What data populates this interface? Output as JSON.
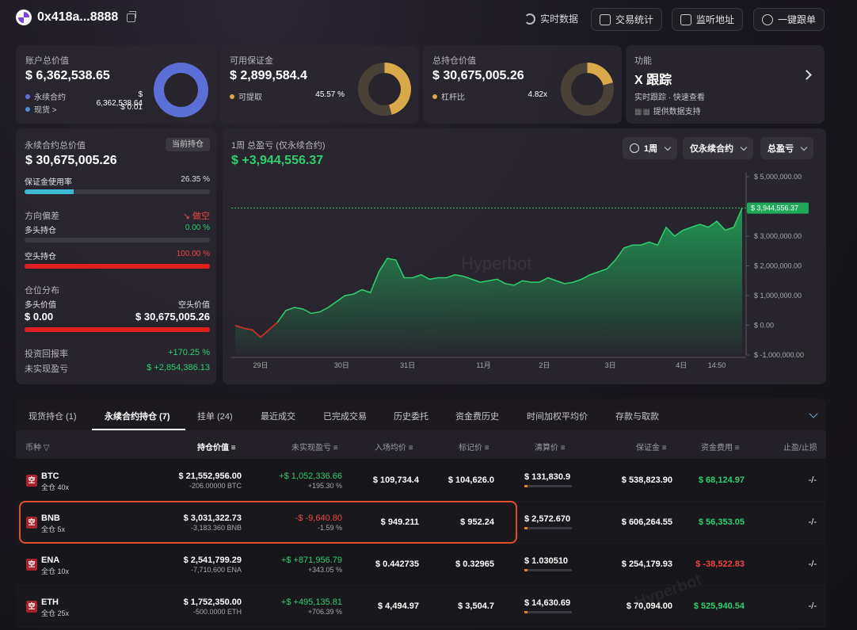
{
  "header": {
    "address": "0x418a...8888",
    "live_label": "实时数据",
    "stats_label": "交易统计",
    "monitor_label": "监听地址",
    "copy_label": "一键跟单"
  },
  "account": {
    "title": "账户总价值",
    "value": "$ 6,362,538.65",
    "perp_label": "永续合约",
    "perp_value": "$ 6,362,538.64",
    "spot_label": "现货 >",
    "spot_value": "$ 0.01",
    "perp_color": "#5b6fd6",
    "spot_color": "#4a8fd8",
    "perp_share": 0.99
  },
  "margin": {
    "title": "可用保证金",
    "value": "$ 2,899,584.4",
    "withdraw_label": "可提取",
    "withdraw_pct": "45.57 %",
    "color": "#d9a949",
    "share": 0.4557
  },
  "holdings": {
    "title": "总持仓价值",
    "value": "$ 30,675,005.26",
    "lev_label": "杠杆比",
    "lev_value": "4.82x",
    "color": "#d9a949",
    "share": 0.21
  },
  "feature": {
    "title": "功能",
    "name": "X 跟踪",
    "desc": "实时跟踪 · 快速查看",
    "support": "提供数据支持"
  },
  "perp_panel": {
    "title": "永续合约总价值",
    "badge": "当前持仓",
    "value": "$ 30,675,005.26",
    "margin_usage_label": "保证金使用率",
    "margin_usage_value": "26.35 %",
    "margin_usage": 0.2635,
    "bias_label": "方向偏差",
    "bias_value": "做空",
    "long_label": "多头持仓",
    "long_pct": "0.00 %",
    "long_share": 0,
    "short_label": "空头持仓",
    "short_pct": "100.00 %",
    "short_share": 1,
    "dist_label": "仓位分布",
    "long_value_label": "多头价值",
    "short_value_label": "空头价值",
    "long_value": "$ 0.00",
    "short_value": "$ 30,675,005.26",
    "roi_label": "投资回报率",
    "roi_value": "+170.25 %",
    "upnl_label": "未实现盈亏",
    "upnl_value": "$ +2,854,386.13"
  },
  "pnl_chart": {
    "title": "1周 总盈亏 (仅永续合约)",
    "value": "$ +3,944,556.37",
    "period": "1周",
    "filter": "仅永续合约",
    "metric": "总盈亏",
    "watermark": "Hyperbot",
    "current_tag": "$ 3,944,556.37"
  },
  "chart_data": {
    "type": "area",
    "title": "1周 总盈亏 (仅永续合约)",
    "x_ticks": [
      "29日",
      "30日",
      "31日",
      "11月",
      "2日",
      "3日",
      "4日",
      "14:50"
    ],
    "y_ticks": [
      "$ 5,000,000.00",
      "$ 4,000,000.00",
      "$ 3,000,000.00",
      "$ 2,000,000.00",
      "$ 1,000,000.00",
      "$ 0.00",
      "$ -1,000,000.00"
    ],
    "ylim": [
      -1000000,
      5000000
    ],
    "values": [
      0,
      -100000,
      -150000,
      -400000,
      -150000,
      100000,
      500000,
      600000,
      550000,
      400000,
      450000,
      600000,
      800000,
      1000000,
      1050000,
      1200000,
      1100000,
      1800000,
      2250000,
      2200000,
      1600000,
      1600000,
      1700000,
      1550000,
      1600000,
      1600000,
      1700000,
      1650000,
      1550000,
      1450000,
      1500000,
      1550000,
      1400000,
      1350000,
      1500000,
      1450000,
      1450000,
      1600000,
      1500000,
      1400000,
      1450000,
      1550000,
      1700000,
      1800000,
      1900000,
      2200000,
      2600000,
      2700000,
      2700000,
      2800000,
      2700000,
      3300000,
      3000000,
      3200000,
      3300000,
      3400000,
      3300000,
      3500000,
      3200000,
      3300000,
      3944556
    ],
    "grid": true
  },
  "tabs": [
    {
      "label": "现货持仓 (1)"
    },
    {
      "label": "永续合约持仓 (7)"
    },
    {
      "label": "挂单 (24)"
    },
    {
      "label": "最近成交"
    },
    {
      "label": "已完成交易"
    },
    {
      "label": "历史委托"
    },
    {
      "label": "资金费历史"
    },
    {
      "label": "时间加权平均价"
    },
    {
      "label": "存款与取款"
    }
  ],
  "table": {
    "headers": [
      "币种",
      "持仓价值",
      "未实现盈亏",
      "入场均价",
      "标记价",
      "清算价",
      "保证金",
      "资金费用",
      "止盈/止损"
    ],
    "rows": [
      {
        "side": "空",
        "symbol": "BTC",
        "mode": "全仓 40x",
        "value": "$ 21,552,956.00",
        "size": "-206.00000 BTC",
        "pnl": "+$ 1,052,336.66",
        "pnl_pct": "+195.30 %",
        "pnl_sign": "pos",
        "entry": "$ 109,734.4",
        "mark": "$ 104,626.0",
        "liq": "$ 131,830.9",
        "margin": "$ 538,823.90",
        "funding": "$ 68,124.97",
        "funding_sign": "pos",
        "tpsl": "-/-"
      },
      {
        "side": "空",
        "symbol": "BNB",
        "mode": "全仓 5x",
        "value": "$ 3,031,322.73",
        "size": "-3,183.360 BNB",
        "pnl": "-$ -9,640.80",
        "pnl_pct": "-1.59 %",
        "pnl_sign": "neg",
        "entry": "$ 949.211",
        "mark": "$ 952.24",
        "liq": "$ 2,572.670",
        "margin": "$ 606,264.55",
        "funding": "$ 56,353.05",
        "funding_sign": "pos",
        "tpsl": "-/-"
      },
      {
        "side": "空",
        "symbol": "ENA",
        "mode": "全仓 10x",
        "value": "$ 2,541,799.29",
        "size": "-7,710,600 ENA",
        "pnl": "+$ +871,956.79",
        "pnl_pct": "+343.05 %",
        "pnl_sign": "pos",
        "entry": "$ 0.442735",
        "mark": "$ 0.32965",
        "liq": "$ 1.030510",
        "margin": "$ 254,179.93",
        "funding": "$ -38,522.83",
        "funding_sign": "neg",
        "tpsl": "-/-"
      },
      {
        "side": "空",
        "symbol": "ETH",
        "mode": "全仓 25x",
        "value": "$ 1,752,350.00",
        "size": "-500.0000 ETH",
        "pnl": "+$ +495,135.81",
        "pnl_pct": "+706.39 %",
        "pnl_sign": "pos",
        "entry": "$ 4,494.97",
        "mark": "$ 3,504.7",
        "liq": "$ 14,630.69",
        "margin": "$ 70,094.00",
        "funding": "$ 525,940.54",
        "funding_sign": "pos",
        "tpsl": "-/-"
      }
    ]
  }
}
